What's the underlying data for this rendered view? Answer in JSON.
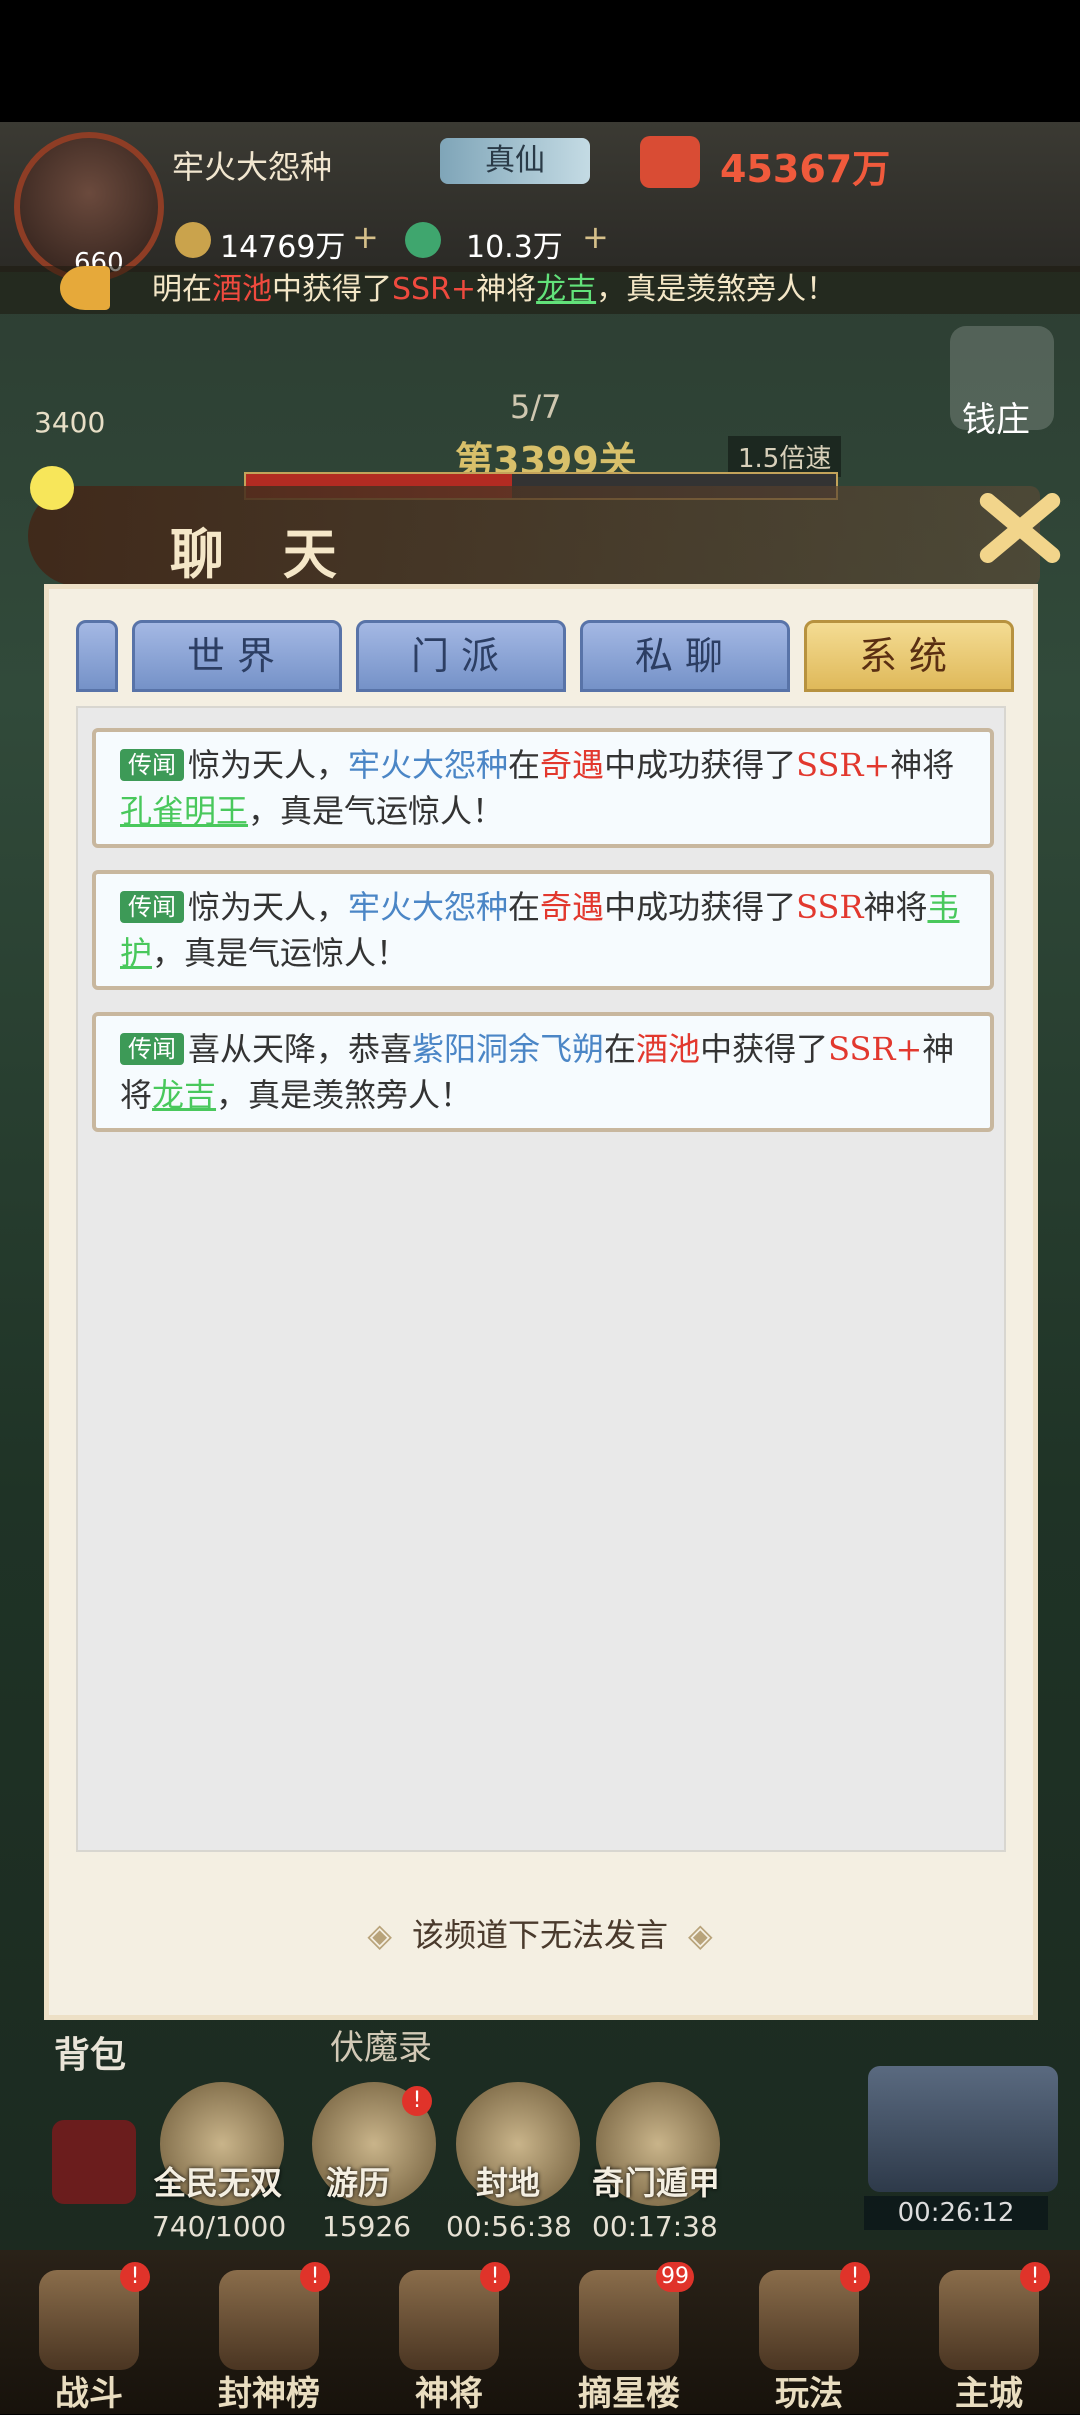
{
  "header": {
    "player_name": "牢火大怨种",
    "level": "660",
    "rank": "真仙",
    "power": "45367万",
    "coins": "14769万",
    "jade": "10.3万"
  },
  "ticker": {
    "part1": "明在",
    "place": "酒池",
    "part2": "中获得了",
    "grade": "SSR+",
    "part3": "神将",
    "hero": "龙吉",
    "part4": "，真是羡煞旁人！"
  },
  "battle": {
    "left_value": "3400",
    "wave": "5/7",
    "stage": "第3399关",
    "speed": "1.5倍速",
    "hp_fraction": 0.45
  },
  "side_buttons": {
    "qianzhuang": "钱庄"
  },
  "chat": {
    "title": "聊 天",
    "tabs": [
      {
        "label": ""
      },
      {
        "label": "世界"
      },
      {
        "label": "门派"
      },
      {
        "label": "私聊"
      },
      {
        "label": "系统"
      }
    ],
    "messages": [
      {
        "tag": "传闻",
        "intro": "惊为天人，",
        "player": "牢火大怨种",
        "at": "在",
        "source": "奇遇",
        "mid": "中成功获得了",
        "grade": "SSR+",
        "general_word": "神将",
        "hero": "孔雀明王",
        "ending": "，真是气运惊人！"
      },
      {
        "tag": "传闻",
        "intro": "惊为天人，",
        "player": "牢火大怨种",
        "at": "在",
        "source": "奇遇",
        "mid": "中成功获得了",
        "grade": "SSR",
        "general_word": "神将",
        "hero": "韦护",
        "ending": "，真是气运惊人！"
      },
      {
        "tag": "传闻",
        "intro": "喜从天降，恭喜",
        "player": "紫阳洞余飞朔",
        "at": "在",
        "source": "酒池",
        "mid": "中获得了",
        "grade": "SSR+",
        "general_word": "神将",
        "hero": "龙吉",
        "ending": "，真是羡煞旁人！"
      }
    ],
    "footer": "该频道下无法发言"
  },
  "lower": {
    "backpack": "背包",
    "fumo": "伏魔录",
    "activities": [
      {
        "label": "全民无双",
        "value": "740/1000"
      },
      {
        "label": "游历",
        "value": "15926"
      },
      {
        "label": "封地",
        "value": "00:56:38"
      },
      {
        "label": "奇门遁甲",
        "value": "00:17:38"
      }
    ],
    "chest_timer": "00:26:12"
  },
  "nav": [
    {
      "label": "战斗"
    },
    {
      "label": "封神榜"
    },
    {
      "label": "神将"
    },
    {
      "label": "摘星楼",
      "badge": "99"
    },
    {
      "label": "玩法"
    },
    {
      "label": "主城"
    }
  ],
  "colors": {
    "accent_red": "#e2382e",
    "player_blue": "#4b86c6",
    "hero_green": "#49c85c",
    "tag_green": "#3d9a57"
  }
}
